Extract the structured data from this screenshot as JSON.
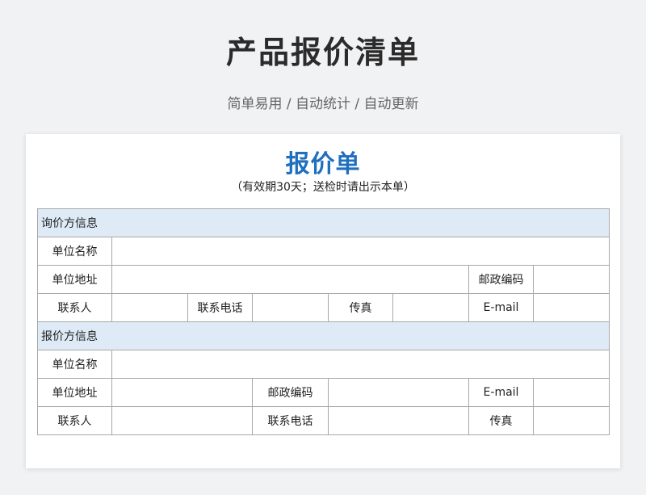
{
  "header": {
    "title": "产品报价清单",
    "subtitle": "简单易用 / 自动统计 / 自动更新"
  },
  "document": {
    "title": "报价单",
    "note": "（有效期30天；送检时请出示本单）",
    "inquirer": {
      "section_label": "询价方信息",
      "company_label": "单位名称",
      "address_label": "单位地址",
      "postcode_label": "邮政编码",
      "contact_label": "联系人",
      "phone_label": "联系电话",
      "fax_label": "传真",
      "email_label": "E-mail"
    },
    "quoter": {
      "section_label": "报价方信息",
      "company_label": "单位名称",
      "address_label": "单位地址",
      "postcode_label": "邮政编码",
      "email_label": "E-mail",
      "contact_label": "联系人",
      "phone_label": "联系电话",
      "fax_label": "传真"
    }
  }
}
